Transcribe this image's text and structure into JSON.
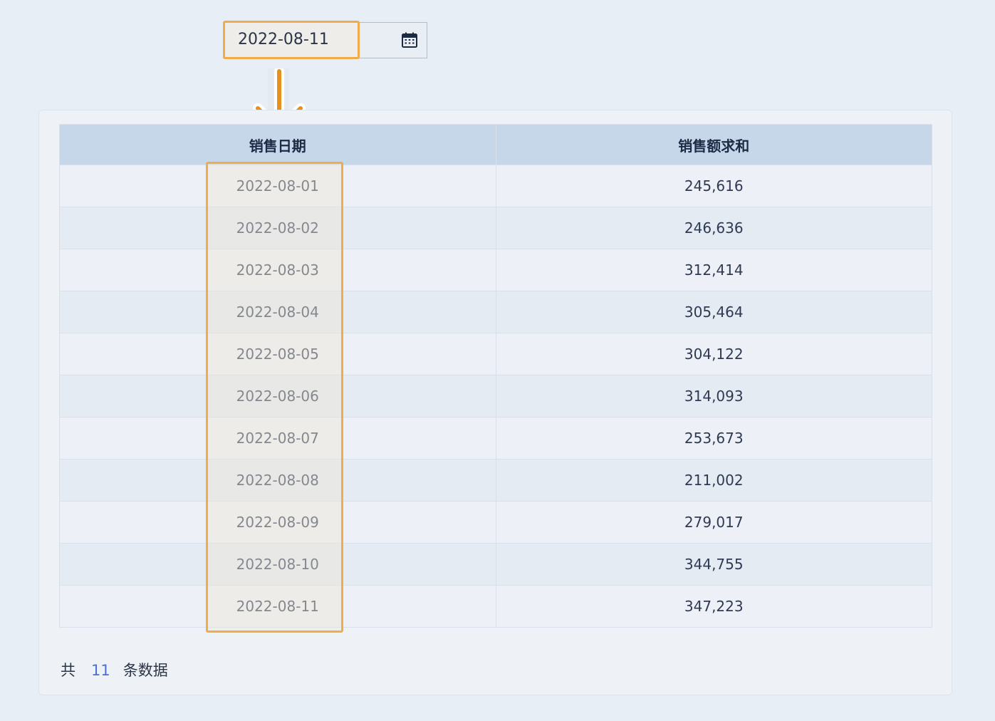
{
  "date_picker": {
    "value": "2022-08-11",
    "icon": "calendar-icon"
  },
  "annotation": {
    "arrow_icon": "arrow-down-icon",
    "highlight_color": "#f0ab4a"
  },
  "table": {
    "columns": [
      "销售日期",
      "销售额求和"
    ],
    "rows": [
      [
        "2022-08-01",
        "245,616"
      ],
      [
        "2022-08-02",
        "246,636"
      ],
      [
        "2022-08-03",
        "312,414"
      ],
      [
        "2022-08-04",
        "305,464"
      ],
      [
        "2022-08-05",
        "304,122"
      ],
      [
        "2022-08-06",
        "314,093"
      ],
      [
        "2022-08-07",
        "253,673"
      ],
      [
        "2022-08-08",
        "211,002"
      ],
      [
        "2022-08-09",
        "279,017"
      ],
      [
        "2022-08-10",
        "344,755"
      ],
      [
        "2022-08-11",
        "347,223"
      ]
    ]
  },
  "footer": {
    "prefix": "共",
    "count": "11",
    "suffix": "条数据"
  }
}
